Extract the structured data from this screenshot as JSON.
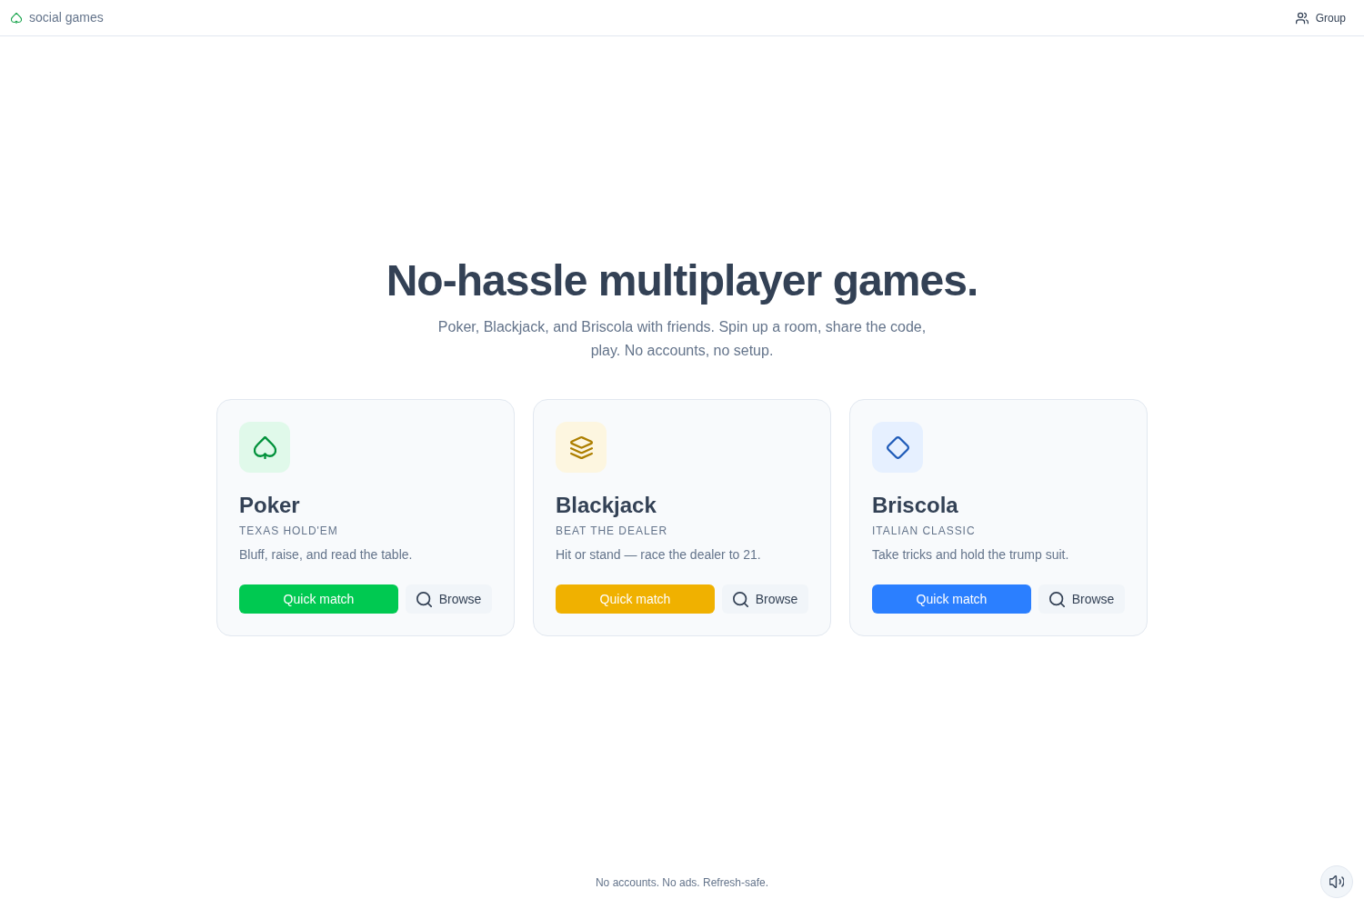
{
  "header": {
    "brand": "social games",
    "group_button": "Group"
  },
  "hero": {
    "title": "No-hassle multiplayer games.",
    "subtitle": "Poker, Blackjack, and Briscola with friends. Spin up a room, share the code, play. No accounts, no setup."
  },
  "games": [
    {
      "kind": "spade",
      "name": "Poker",
      "tagline": "TEXAS HOLD'EM",
      "description": "Bluff, raise, and read the table.",
      "color": "#00c951",
      "primary_action": "Quick match",
      "secondary_action": "Browse"
    },
    {
      "kind": "layers",
      "name": "Blackjack",
      "tagline": "BEAT THE DEALER",
      "description": "Hit or stand — race the dealer to 21.",
      "color": "#f0b100",
      "primary_action": "Quick match",
      "secondary_action": "Browse"
    },
    {
      "kind": "diamond",
      "name": "Briscola",
      "tagline": "ITALIAN CLASSIC",
      "description": "Take tricks and hold the trump suit.",
      "color": "#2b7fff",
      "primary_action": "Quick match",
      "secondary_action": "Browse"
    }
  ],
  "footer": {
    "note": "No accounts. No ads. Refresh-safe."
  }
}
